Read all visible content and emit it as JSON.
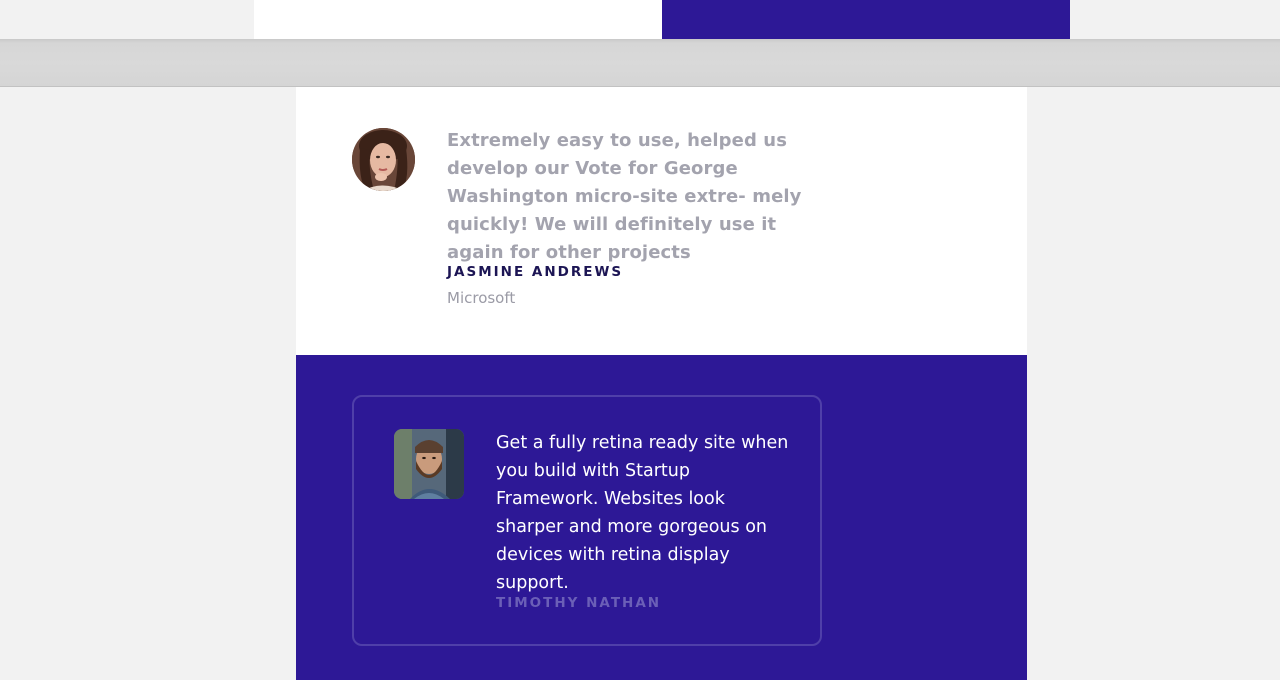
{
  "colors": {
    "page_bg": "#f2f2f2",
    "panel_white": "#ffffff",
    "brand_purple": "#2d1896",
    "card_border": "#4f3fa9",
    "quote_light_text": "#a3a3ae",
    "author_dark_text": "#1c1554",
    "author_muted_text": "#6b5fb7"
  },
  "testimonial_light": {
    "avatar": "woman-portrait-avatar",
    "quote": "Extremely easy to use, helped us develop our Vote for George Washington micro-site extre- mely quickly! We will definitely use it again for other projects",
    "author": "JASMINE ANDREWS",
    "company": "Microsoft"
  },
  "testimonial_dark": {
    "avatar": "bearded-man-portrait-avatar",
    "quote": "Get a fully retina ready site when you build with Startup Framework. Websites look sharper and more gorgeous on devices with retina display support.",
    "author": "TIMOTHY NATHAN"
  }
}
